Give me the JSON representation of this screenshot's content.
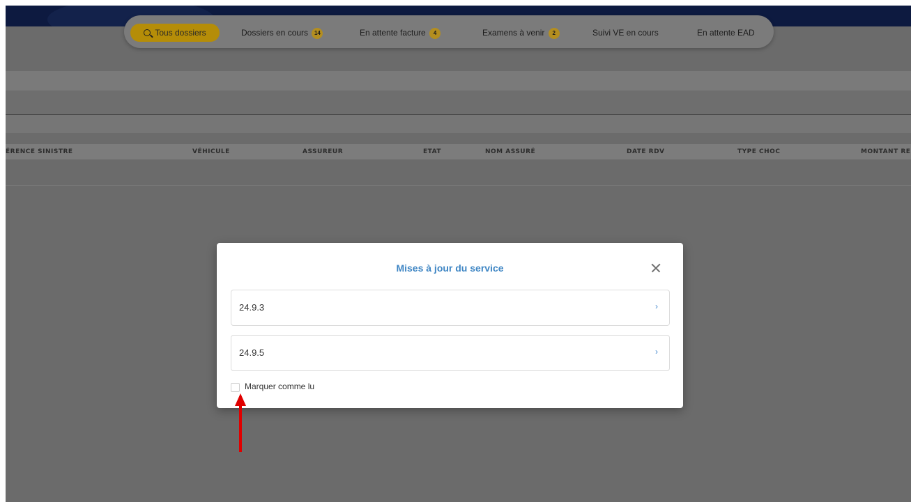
{
  "nav": {
    "tabs": [
      {
        "label": "Tous dossiers",
        "active": true,
        "icon": "search-icon"
      },
      {
        "label": "Dossiers en cours",
        "badge": "14"
      },
      {
        "label": "En attente facture",
        "badge": "4"
      },
      {
        "label": "Examens à venir",
        "badge": "2"
      },
      {
        "label": "Suivi VE en cours"
      },
      {
        "label": "En attente EAD"
      }
    ]
  },
  "table": {
    "headers": [
      "ÉRENCE SINISTRE",
      "VÉHICULE",
      "ASSUREUR",
      "ETAT",
      "NOM ASSURÉ",
      "DATE RDV",
      "TYPE CHOC",
      "MONTANT RE"
    ]
  },
  "modal": {
    "title": "Mises à jour du service",
    "items": [
      {
        "label": "24.9.3",
        "chevron": "›"
      },
      {
        "label": "24.9.5",
        "chevron": "›"
      }
    ],
    "checkbox_label": "Marquer comme lu",
    "checkbox_checked": false
  },
  "annotation": {
    "arrow_color": "#e00000"
  },
  "colors": {
    "accent": "#b58d08",
    "title_blue": "#3f86c4",
    "overlay": "#6b6b6b",
    "topbar": "#0d1a40"
  }
}
